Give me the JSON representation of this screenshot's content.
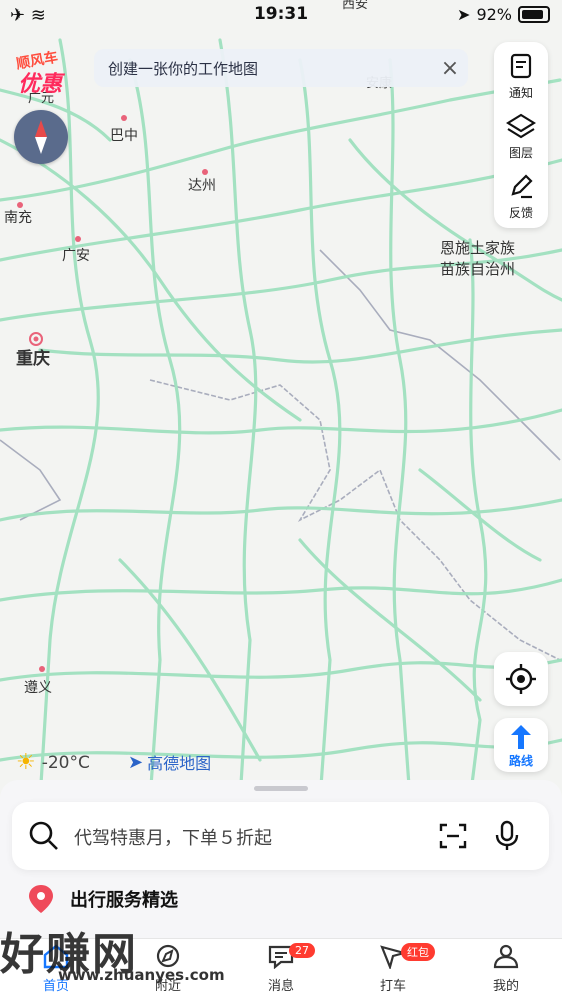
{
  "status_bar": {
    "time": "19:31",
    "battery": "92%"
  },
  "promo": {
    "top": "顺风车",
    "bottom": "优惠"
  },
  "banner": {
    "text": "创建一张你的工作地图",
    "close": "×"
  },
  "map_labels": [
    {
      "name": "广元",
      "kind": "city"
    },
    {
      "name": "西安",
      "kind": "city"
    },
    {
      "name": "安康",
      "kind": "city"
    },
    {
      "name": "巴中",
      "kind": "city"
    },
    {
      "name": "达州",
      "kind": "city"
    },
    {
      "name": "南充",
      "kind": "city"
    },
    {
      "name": "广安",
      "kind": "city"
    },
    {
      "name": "重庆",
      "kind": "capital"
    },
    {
      "name": "恩施土家族",
      "kind": "region"
    },
    {
      "name": "苗族自治州",
      "kind": "region"
    },
    {
      "name": "遵义",
      "kind": "city"
    }
  ],
  "tools": [
    {
      "label": "通知",
      "icon": "notice-icon"
    },
    {
      "label": "图层",
      "icon": "layers-icon"
    },
    {
      "label": "反馈",
      "icon": "feedback-icon"
    }
  ],
  "route_button": {
    "label": "路线"
  },
  "weather": {
    "temp": "-20°C",
    "icon": "sun-icon"
  },
  "amap_brand": "高德地图",
  "search": {
    "placeholder": "代驾特惠月，下单５折起"
  },
  "services": {
    "title": "出行服务精选"
  },
  "tabs": [
    {
      "label": "首页",
      "icon": "home-icon",
      "active": true
    },
    {
      "label": "附近",
      "icon": "nearby-icon"
    },
    {
      "label": "消息",
      "icon": "message-icon",
      "badge": "27"
    },
    {
      "label": "打车",
      "icon": "taxi-icon",
      "badge": "红包"
    },
    {
      "label": "我的",
      "icon": "profile-icon"
    }
  ],
  "watermark": {
    "text": "好赚网",
    "url": "www.zhuanyes.com"
  },
  "colors": {
    "road": "#9fe1bf",
    "accent": "#1677ff",
    "badge": "#ff3b30",
    "boundary": "#a9adbd"
  }
}
